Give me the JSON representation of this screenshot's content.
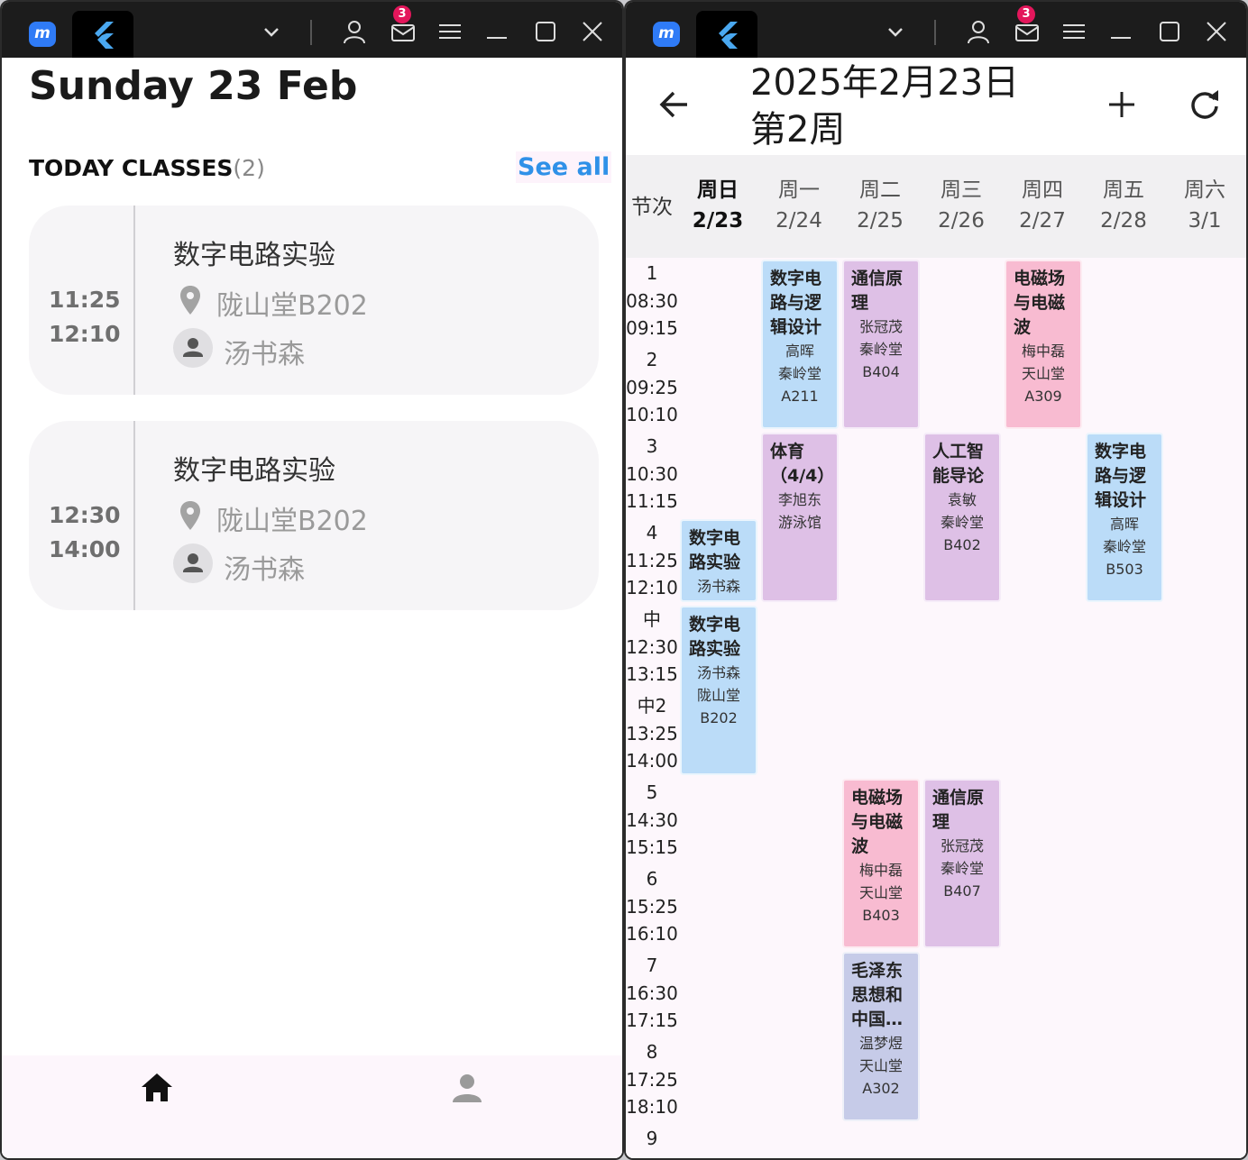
{
  "left_window": {
    "badge_count": "3",
    "date_title": "Sunday 23 Feb",
    "today_label": "TODAY CLASSES",
    "today_count": "(2)",
    "see_all": "See all",
    "classes": [
      {
        "start": "11:25",
        "end": "12:10",
        "name": "数字电路实验",
        "location": "陇山堂B202",
        "teacher": "汤书森"
      },
      {
        "start": "12:30",
        "end": "14:00",
        "name": "数字电路实验",
        "location": "陇山堂B202",
        "teacher": "汤书森"
      }
    ],
    "nav": [
      "home-icon",
      "person-icon"
    ]
  },
  "right_window": {
    "badge_count": "3",
    "title_line1": "2025年2月23日",
    "title_line2": "第2周",
    "period_header": "节次",
    "days": [
      {
        "name": "周日",
        "date": "2/23"
      },
      {
        "name": "周一",
        "date": "2/24"
      },
      {
        "name": "周二",
        "date": "2/25"
      },
      {
        "name": "周三",
        "date": "2/26"
      },
      {
        "name": "周四",
        "date": "2/27"
      },
      {
        "name": "周五",
        "date": "2/28"
      },
      {
        "name": "周六",
        "date": "3/1"
      }
    ],
    "periods": [
      {
        "label": "1",
        "start": "08:30",
        "end": "09:15"
      },
      {
        "label": "2",
        "start": "09:25",
        "end": "10:10"
      },
      {
        "label": "3",
        "start": "10:30",
        "end": "11:15"
      },
      {
        "label": "4",
        "start": "11:25",
        "end": "12:10"
      },
      {
        "label": "中",
        "start": "12:30",
        "end": "13:15"
      },
      {
        "label": "中2",
        "start": "13:25",
        "end": "14:00"
      },
      {
        "label": "5",
        "start": "14:30",
        "end": "15:15"
      },
      {
        "label": "6",
        "start": "15:25",
        "end": "16:10"
      },
      {
        "label": "7",
        "start": "16:30",
        "end": "17:15"
      },
      {
        "label": "8",
        "start": "17:25",
        "end": "18:10"
      },
      {
        "label": "9",
        "start": "",
        "end": ""
      }
    ],
    "courses": [
      {
        "name": "数字电路与逻辑设计",
        "teacher": "高晖",
        "room": "秦岭堂A211"
      },
      {
        "name": "通信原理",
        "teacher": "张冠茂",
        "room": "秦岭堂B404"
      },
      {
        "name": "电磁场与电磁波",
        "teacher": "梅中磊",
        "room": "天山堂A309"
      },
      {
        "name": "体育（4/4）",
        "teacher": "李旭东",
        "room": "游泳馆"
      },
      {
        "name": "人工智能导论",
        "teacher": "袁敏",
        "room": "秦岭堂B402"
      },
      {
        "name": "数字电路与逻辑设计",
        "teacher": "高晖",
        "room": "秦岭堂B503"
      },
      {
        "name": "数字电路实验",
        "teacher": "汤书森",
        "room": ""
      },
      {
        "name": "数字电路实验",
        "teacher": "汤书森",
        "room": "陇山堂B202"
      },
      {
        "name": "电磁场与电磁波",
        "teacher": "梅中磊",
        "room": "天山堂B403"
      },
      {
        "name": "通信原理",
        "teacher": "张冠茂",
        "room": "秦岭堂B407"
      },
      {
        "name": "毛泽东思想和中国…",
        "teacher": "温梦煜",
        "room": "天山堂A302"
      }
    ],
    "colors": {
      "blue": "#bbdcf8",
      "purple": "#dec0e6",
      "pink": "#f8bbd1",
      "lavender": "#c6cbe8"
    }
  }
}
